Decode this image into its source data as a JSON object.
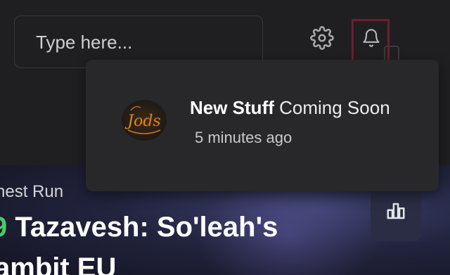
{
  "search": {
    "placeholder": "Type here..."
  },
  "header": {
    "settings_icon": "gear-icon",
    "notifications_icon": "bell-icon",
    "accent_color": "#6d1f30"
  },
  "notifications": [
    {
      "logo_text": "Jods",
      "title_bold": "New Stuff",
      "title_rest": " Coming Soon",
      "time": "5 minutes ago"
    }
  ],
  "hero": {
    "subtitle": "nest Run",
    "title_number": "9",
    "title_text": " Tazavesh: So'leah's",
    "title_line2": "ambit EU",
    "stats_icon": "bar-chart-icon",
    "number_color": "#4cc96a"
  }
}
